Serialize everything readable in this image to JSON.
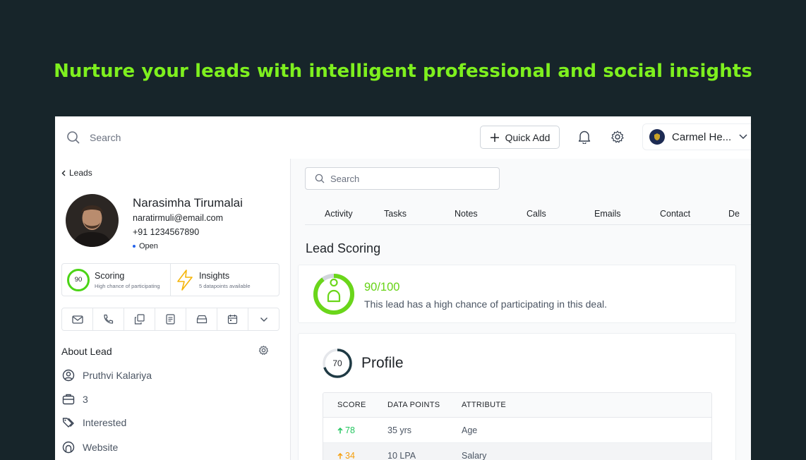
{
  "headline": "Nurture your leads with intelligent professional and social insights",
  "topbar": {
    "search_placeholder": "Search",
    "quick_add_label": "Quick Add",
    "user_name": "Carmel He..."
  },
  "left_panel": {
    "back_label": "Leads",
    "lead": {
      "name": "Narasimha Tirumalai",
      "email": "naratirmuli@email.com",
      "phone": "+91 1234567890",
      "status": "Open"
    },
    "scoring_card": {
      "value": "90",
      "title": "Scoring",
      "subtitle": "High chance of participating"
    },
    "insights_card": {
      "title": "Insights",
      "subtitle": "5 datapoints available"
    },
    "actions": [
      "mail-icon",
      "phone-icon",
      "copy-icon",
      "document-icon",
      "archive-icon",
      "calendar-icon",
      "chevron-down-icon"
    ],
    "about": {
      "title": "About Lead",
      "owner": "Pruthvi Kalariya",
      "count": "3",
      "tag": "Interested",
      "source": "Website"
    }
  },
  "right_panel": {
    "search_placeholder": "Search",
    "tabs": [
      "Activity",
      "Tasks",
      "Notes",
      "Calls",
      "Emails",
      "Contact",
      "De"
    ],
    "lead_scoring": {
      "title": "Lead Scoring",
      "score": "90/100",
      "score_fraction": 0.9,
      "description": "This lead has a high chance of participating in this deal."
    },
    "profile": {
      "title": "Profile",
      "score": "70",
      "score_fraction": 0.7,
      "columns": [
        "SCORE",
        "DATA POINTS",
        "ATTRIBUTE"
      ],
      "rows": [
        {
          "score": "78",
          "score_color": "#22c55e",
          "data_point": "35 yrs",
          "attribute": "Age"
        },
        {
          "score": "34",
          "score_color": "#f59e0b",
          "data_point": "10 LPA",
          "attribute": "Salary"
        }
      ]
    }
  },
  "colors": {
    "background": "#17252a",
    "headline": "#7ef01e",
    "score_green": "#67d316"
  }
}
